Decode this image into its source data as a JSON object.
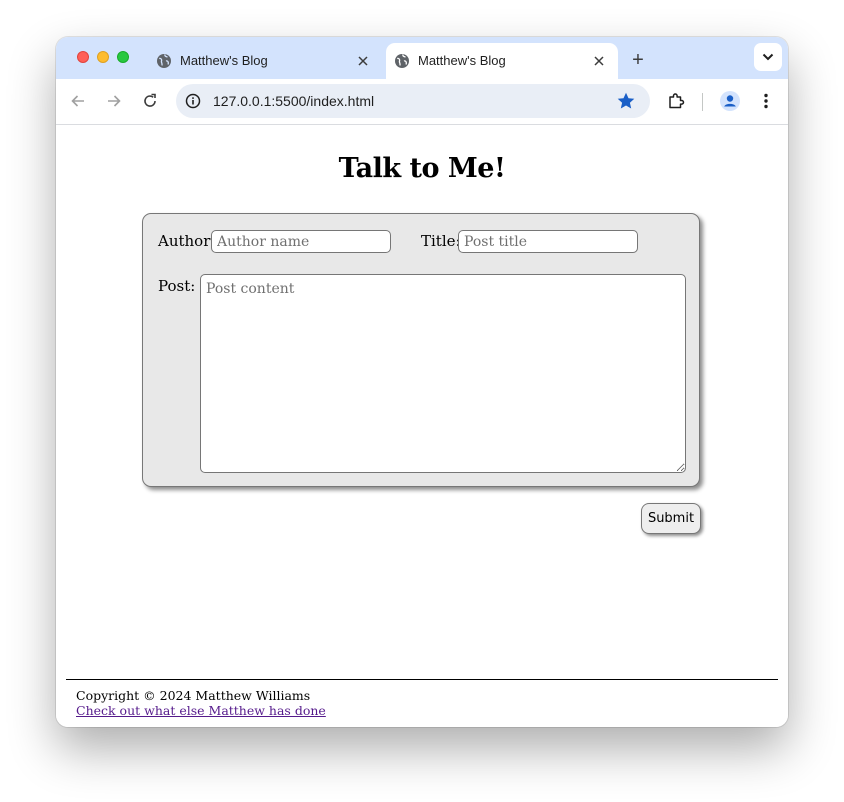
{
  "browser": {
    "tabs": [
      {
        "title": "Matthew's Blog",
        "active": false
      },
      {
        "title": "Matthew's Blog",
        "active": true
      }
    ],
    "new_tab_label": "+",
    "url": "127.0.0.1:5500/index.html",
    "bookmarked": true,
    "accent_color": "#1a73e8"
  },
  "page": {
    "heading": "Talk to Me!",
    "form": {
      "author_label": "Author:",
      "author_placeholder": "Author name",
      "author_value": "",
      "title_label": "Title:",
      "title_placeholder": "Post title",
      "title_value": "",
      "post_label": "Post:",
      "post_placeholder": "Post content",
      "post_value": ""
    },
    "submit_label": "Submit",
    "footer": {
      "copyright": "Copyright © 2024 Matthew Williams",
      "link_text": "Check out what else Matthew has done"
    }
  }
}
